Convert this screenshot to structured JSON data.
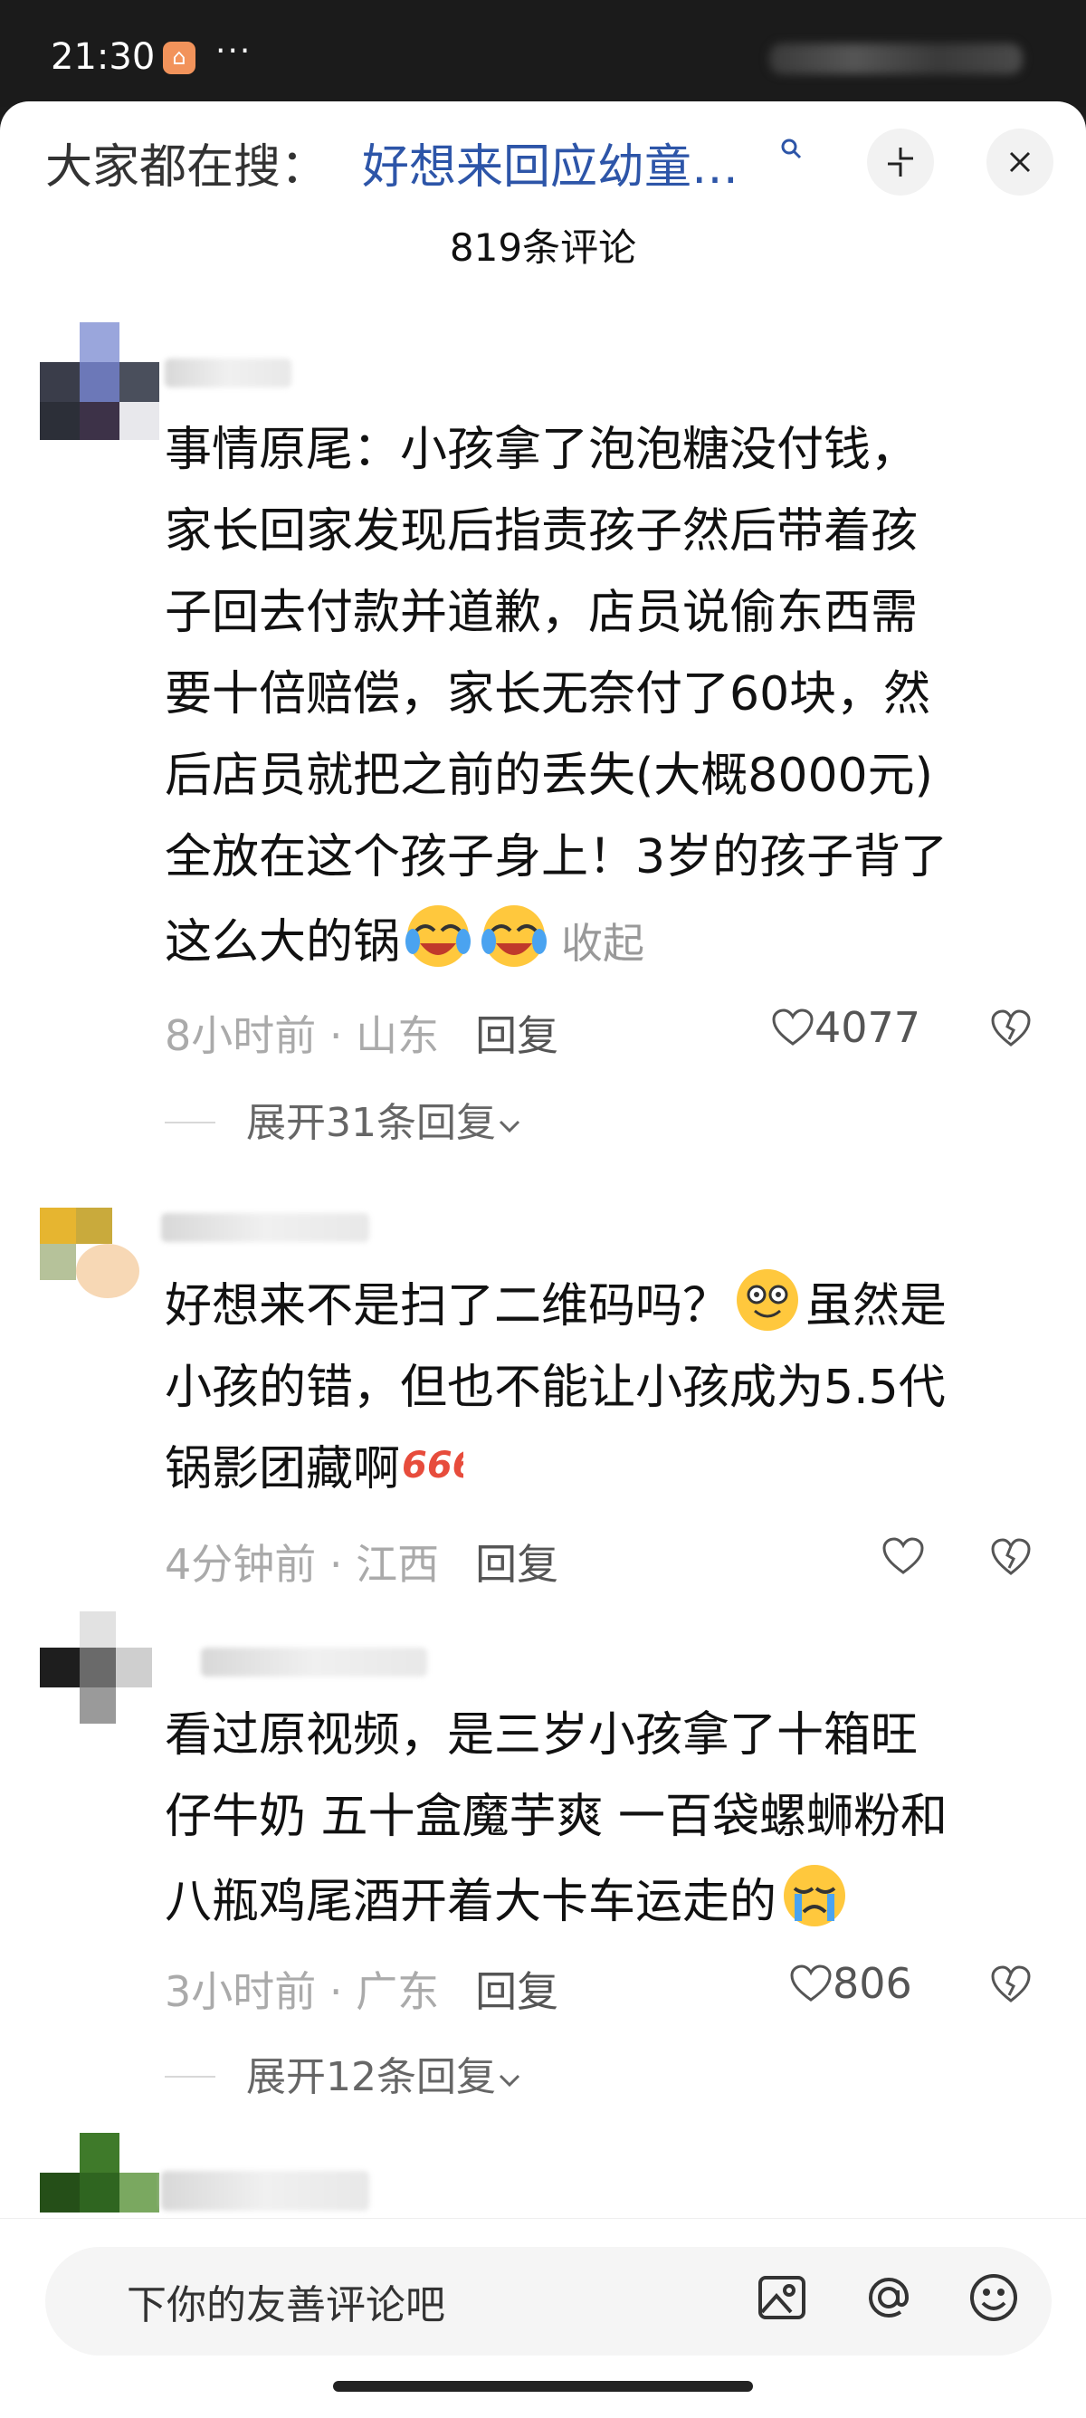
{
  "status_bar": {
    "time": "21:30",
    "more": "···"
  },
  "header": {
    "prefix": "大家都在搜：",
    "search_link": "好想来回应幼童…",
    "comment_count": "819条评论"
  },
  "comments": [
    {
      "lines": [
        "事情原尾：小孩拿了泡泡糖没付钱，",
        "家长回家发现后指责孩子然后带着孩",
        "子回去付款并道歉，店员说偷东西需",
        "要十倍赔偿，家长无奈付了60块，然",
        "后店员就把之前的丢失(大概8000元)",
        "全放在这个孩子身上！3岁的孩子背了",
        "这么大的锅"
      ],
      "collapse_label": "收起",
      "time": "8小时前",
      "location": "山东",
      "reply_label": "回复",
      "likes": "4077",
      "expand_label": "展开31条回复"
    },
    {
      "lines": [
        "好想来不是扫了二维码吗？",
        "虽然是",
        "小孩的错，但也不能让小孩成为5.5代",
        "锅影团藏啊"
      ],
      "time": "4分钟前",
      "location": "江西",
      "reply_label": "回复"
    },
    {
      "lines": [
        "看过原视频，是三岁小孩拿了十箱旺",
        "仔牛奶 五十盒魔芋爽 一百袋螺蛳粉和",
        "八瓶鸡尾酒开着大卡车运走的"
      ],
      "time": "3小时前",
      "location": "广东",
      "reply_label": "回复",
      "likes": "806",
      "expand_label": "展开12条回复"
    }
  ],
  "input": {
    "placeholder": "下你的友善评论吧"
  },
  "colors": {
    "link": "#2d55a8",
    "meta": "#aaaaaa",
    "text": "#111111"
  }
}
